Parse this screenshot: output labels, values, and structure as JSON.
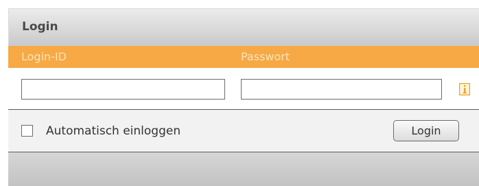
{
  "panel": {
    "title": "Login"
  },
  "labels": {
    "login_id": "Login-ID",
    "password": "Passwort"
  },
  "fields": {
    "login_id_value": "",
    "password_value": ""
  },
  "info_icon": {
    "name": "info-icon",
    "glyph": "i"
  },
  "options": {
    "auto_login_label": "Automatisch einloggen",
    "auto_login_checked": false
  },
  "actions": {
    "login_button_label": "Login"
  },
  "colors": {
    "accent": "#f6a944",
    "label_text": "#fde3bd",
    "info_icon": "#f0a020"
  }
}
